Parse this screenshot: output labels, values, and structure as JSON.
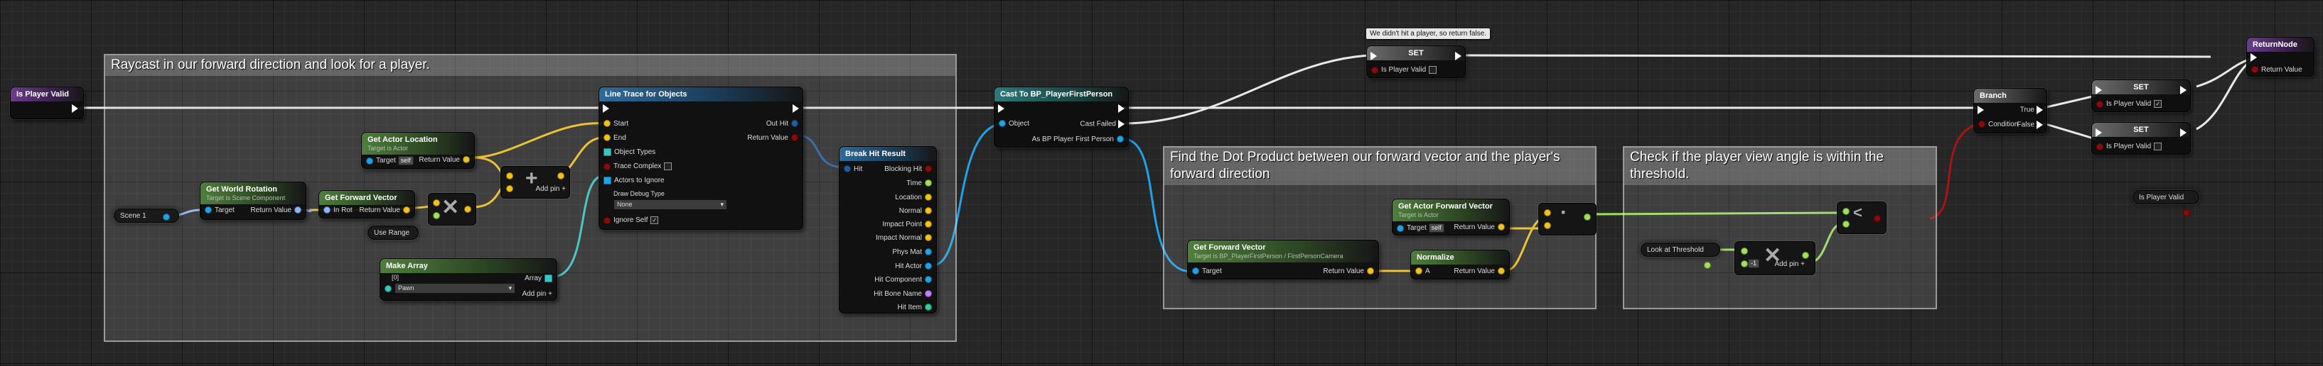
{
  "comments": {
    "raycast": "Raycast in our forward direction and look for a player.",
    "dot_product": "Find the Dot Product between our forward vector and the player's forward direction",
    "threshold": "Check if the player view angle is within the threshold."
  },
  "bubble": {
    "note": "We didn't hit a player, so return false."
  },
  "nodes": {
    "is_player_valid_entry": {
      "title": "Is Player Valid"
    },
    "get_world_rotation": {
      "title": "Get World Rotation",
      "subtitle": "Target is Scene Component",
      "target": "Target",
      "return_value": "Return Value"
    },
    "scene1": {
      "label": "Scene 1"
    },
    "get_forward_vector": {
      "title": "Get Forward Vector",
      "in_rot": "In Rot",
      "return_value": "Return Value"
    },
    "get_actor_location": {
      "title": "Get Actor Location",
      "subtitle": "Target is Actor",
      "target": "Target",
      "self": "self",
      "return_value": "Return Value"
    },
    "get_actor_location2": {
      "subtitle": "Target is Actor"
    },
    "use_range": {
      "label": "Use Range"
    },
    "add_pin": {
      "label": "Add pin"
    },
    "line_trace": {
      "title": "Line Trace for Objects",
      "start": "Start",
      "end": "End",
      "object_types": "Object Types",
      "trace_complex": "Trace Complex",
      "actors_to_ignore": "Actors to Ignore",
      "draw_debug_type": "Draw Debug Type",
      "draw_debug_value": "None",
      "ignore_self": "Ignore Self",
      "out_hit": "Out Hit",
      "return_value": "Return Value"
    },
    "make_array": {
      "title": "Make Array",
      "index0": "[0]",
      "pawn": "Pawn",
      "array": "Array",
      "add_pin": "Add pin"
    },
    "break_hit_result": {
      "title": "Break Hit Result",
      "hit": "Hit",
      "outputs": [
        "Blocking Hit",
        "Time",
        "Location",
        "Normal",
        "Impact Point",
        "Impact Normal",
        "Phys Mat",
        "Hit Actor",
        "Hit Component",
        "Hit Bone Name",
        "Hit Item"
      ]
    },
    "cast": {
      "title": "Cast To BP_PlayerFirstPerson",
      "object": "Object",
      "cast_failed": "Cast Failed",
      "as_bp": "As BP Player First Person"
    },
    "set_top": {
      "title": "SET",
      "is_player_valid": "Is Player Valid"
    },
    "get_forward_vector2": {
      "title": "Get Forward Vector",
      "subtitle": "Target is BP_PlayerFirstPerson / FirstPersonCamera",
      "target": "Target",
      "return_value": "Return Value"
    },
    "get_actor_forward_vector": {
      "title": "Get Actor Forward Vector",
      "subtitle": "Target is Actor",
      "target": "Target",
      "self": "self",
      "return_value": "Return Value"
    },
    "normalize": {
      "title": "Normalize",
      "a": "A",
      "return_value": "Return Value"
    },
    "look_at_threshold": {
      "label": "Look at Threshold"
    },
    "add_pin2": {
      "label": "Add pin"
    },
    "branch": {
      "title": "Branch",
      "condition": "Condition",
      "true": "True",
      "false": "False"
    },
    "set_true": {
      "title": "SET",
      "is_player_valid": "Is Player Valid",
      "checked": "✓"
    },
    "set_false": {
      "title": "SET",
      "is_player_valid": "Is Player Valid"
    },
    "return_node": {
      "title": "ReturnNode",
      "return_value": "Return Value"
    },
    "is_player_valid_getter": {
      "label": "Is Player Valid"
    }
  },
  "colors": {
    "exec": "#ffffff",
    "vector": "#f2c21a",
    "object": "#1fa3e6",
    "bool": "#8c0a0a",
    "struct": "#1f5fa0",
    "float": "#9de05a"
  }
}
